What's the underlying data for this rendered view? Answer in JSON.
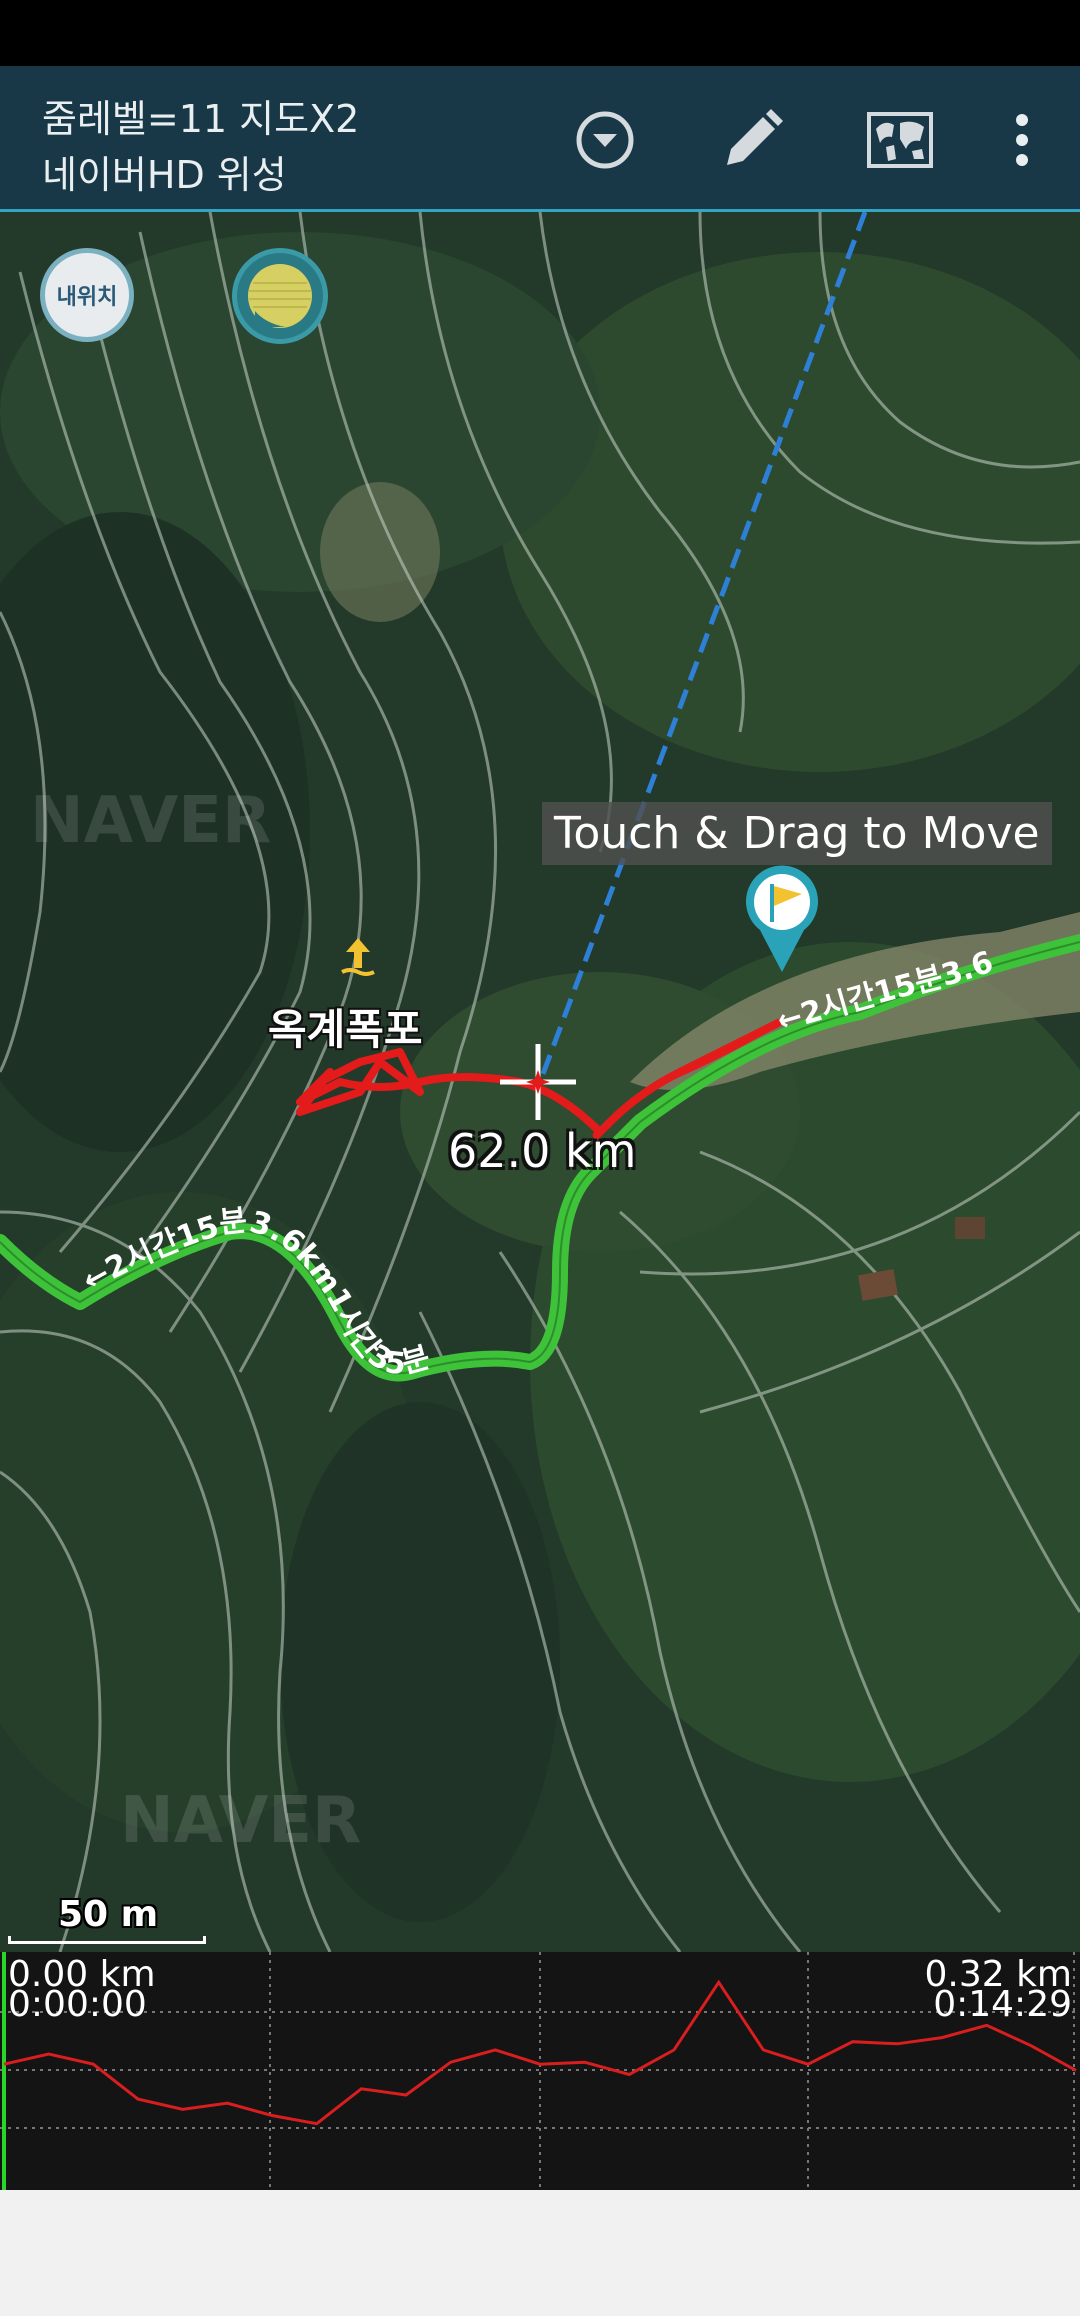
{
  "app_bar": {
    "title_line1": "줌레벨=11 지도X2",
    "title_line2": "네이버HD 위성",
    "actions": [
      {
        "name": "dropdown",
        "icon": "chevron-down-circle-icon"
      },
      {
        "name": "edit",
        "icon": "pencil-icon"
      },
      {
        "name": "map-view",
        "icon": "world-map-icon"
      },
      {
        "name": "overflow",
        "icon": "more-vert-icon"
      }
    ],
    "color": "#183848",
    "accent": "#35a5c4"
  },
  "map": {
    "my_location_label": "내위치",
    "drag_hint": "Touch & Drag to Move",
    "place_label": "옥계폭포",
    "distance_label": "62.0 km",
    "scale_label": "50 m",
    "trail_labels": [
      "←2시간15분3.6km1시간35분",
      "←2시간15분3.6"
    ],
    "watermark": "NAVER",
    "colors": {
      "track": "#e31b1b",
      "trail": "#3ec23a",
      "direction_line": "#2e7fd6",
      "flag": "#2aa3b8"
    }
  },
  "profile": {
    "start_distance": "0.00 km",
    "start_time": "0:00:00",
    "end_distance": "0.32 km",
    "end_time": "0:14:29",
    "line_color": "#d81e1e",
    "elevation_series": [
      0.55,
      0.6,
      0.55,
      0.38,
      0.33,
      0.36,
      0.3,
      0.26,
      0.43,
      0.4,
      0.56,
      0.62,
      0.55,
      0.56,
      0.5,
      0.62,
      0.95,
      0.62,
      0.55,
      0.66,
      0.65,
      0.68,
      0.74,
      0.64,
      0.52
    ]
  }
}
